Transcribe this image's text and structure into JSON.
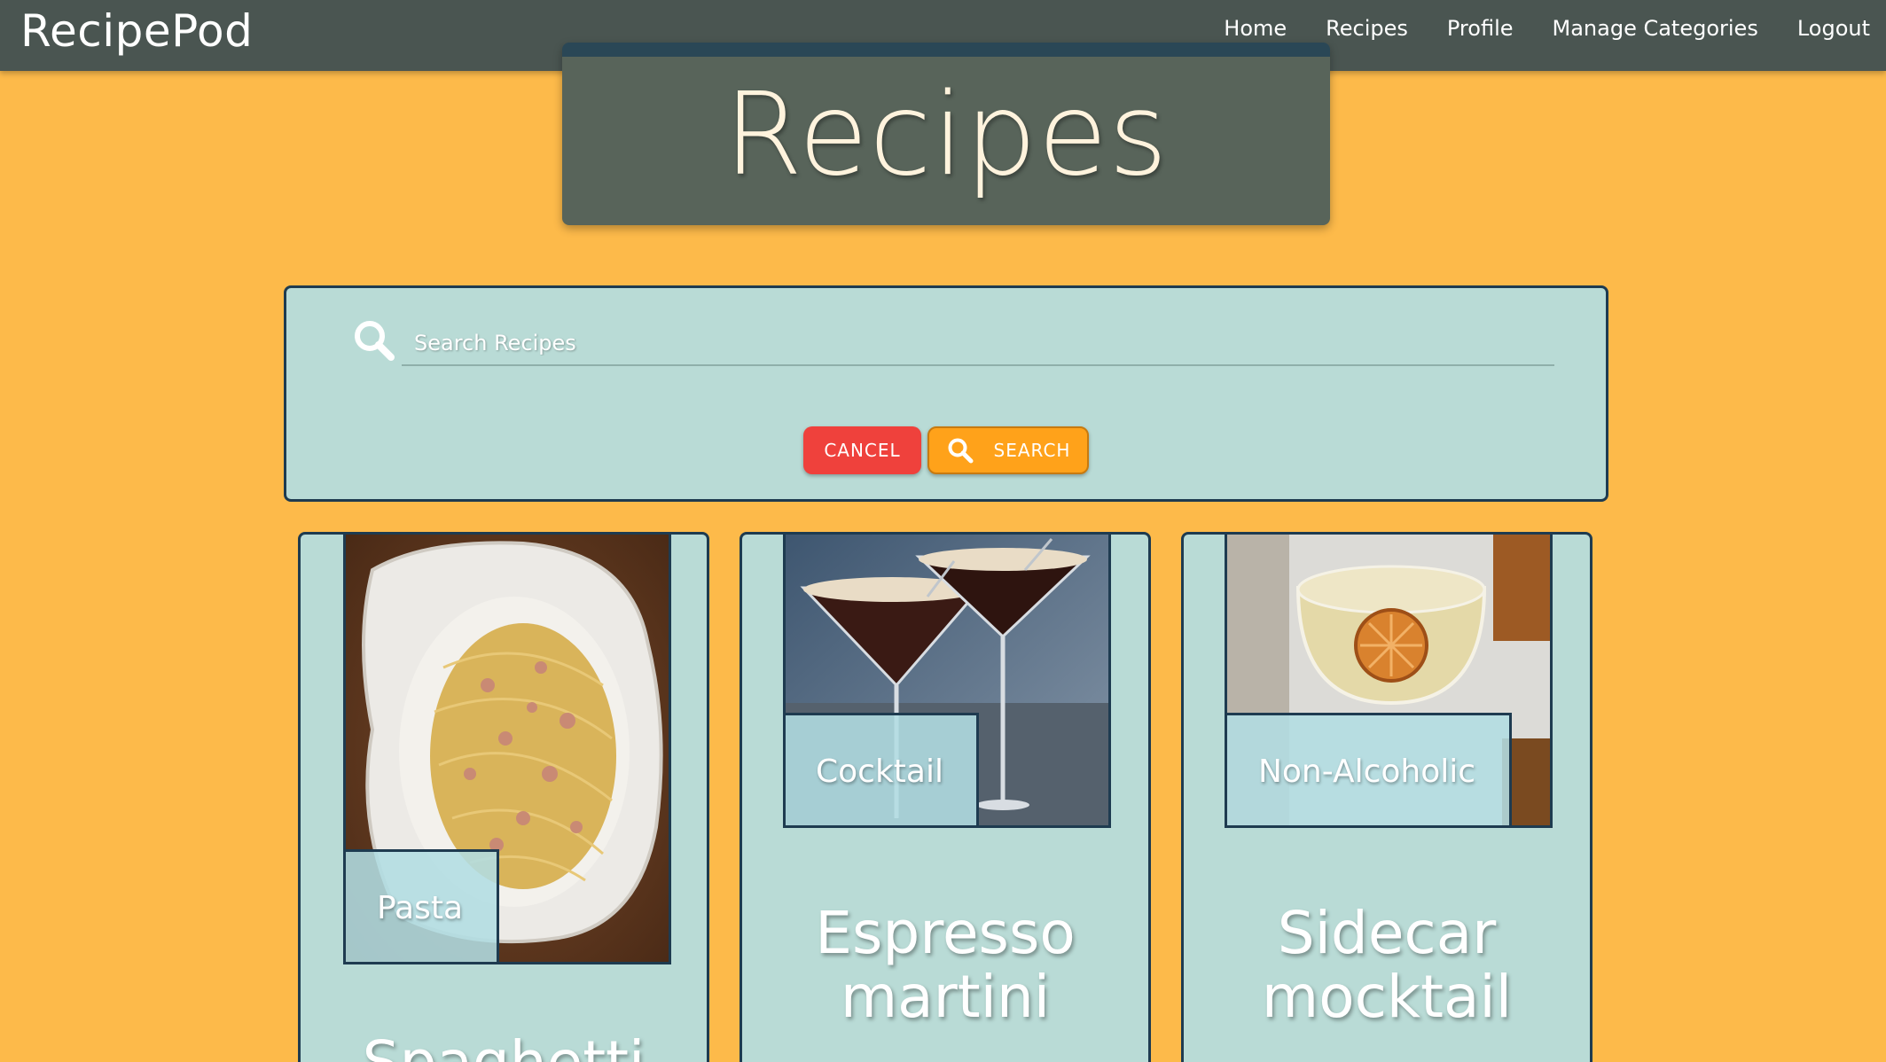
{
  "brand": "RecipePod",
  "nav": {
    "items": [
      "Home",
      "Recipes",
      "Profile",
      "Manage Categories",
      "Logout"
    ]
  },
  "page_title": "Recipes",
  "search": {
    "placeholder": "Search Recipes",
    "cancel_label": "CANCEL",
    "search_label": "SEARCH"
  },
  "recipes": [
    {
      "category": "Pasta",
      "title": "Spaghetti"
    },
    {
      "category": "Cocktail",
      "title": "Espresso martini"
    },
    {
      "category": "Non-Alcoholic",
      "title": "Sidecar mocktail"
    }
  ],
  "colors": {
    "background": "#FDBA4A",
    "navbar": "#4A5551",
    "panel": "#B9DBD6",
    "cancel": "#EF413C",
    "search": "#FFA21A"
  }
}
